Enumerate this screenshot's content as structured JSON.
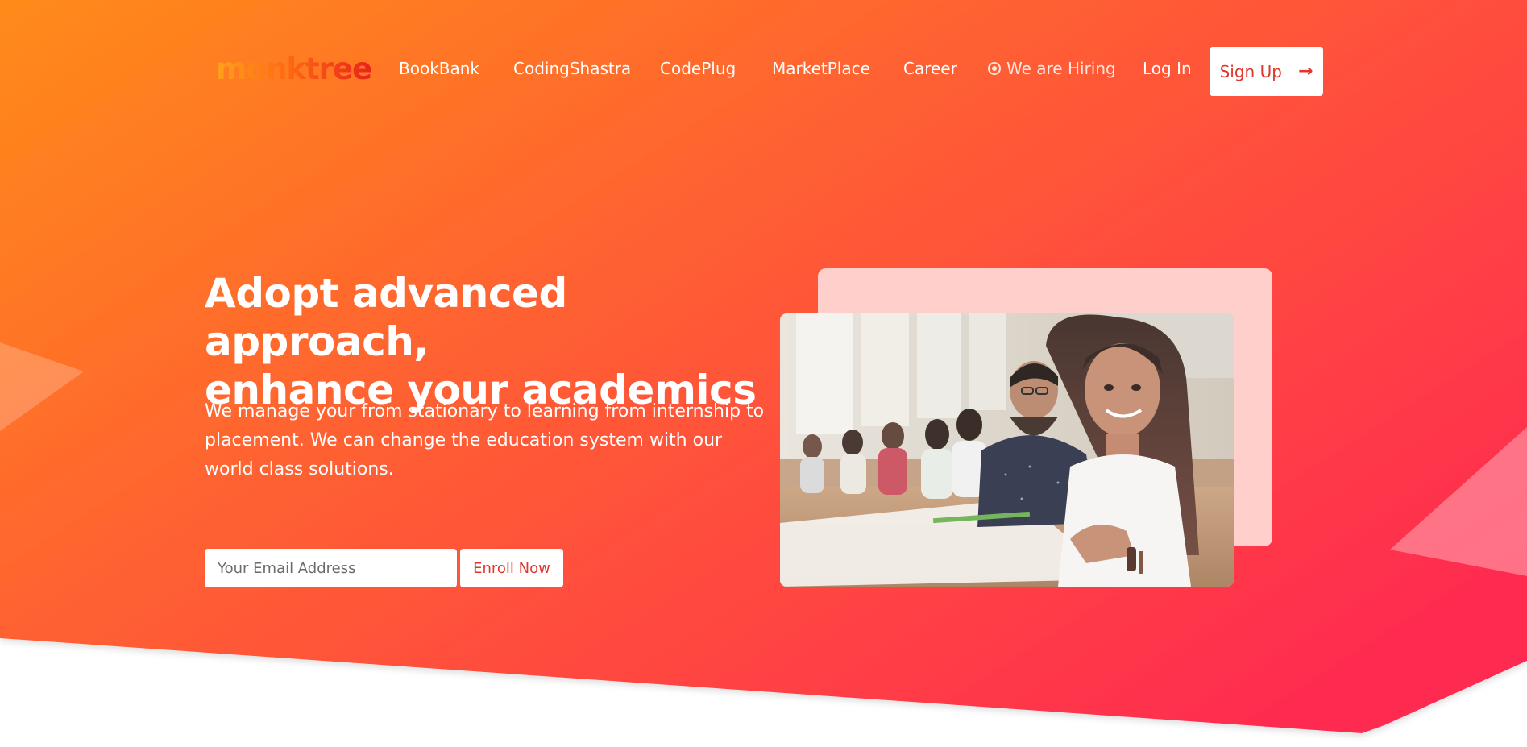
{
  "brand": {
    "logo_text": "monktree",
    "accent": "#e0362b",
    "gradient_start": "#ff8c1a",
    "gradient_end": "#ff2e4f"
  },
  "nav": {
    "items": [
      {
        "label": "BookBank"
      },
      {
        "label": "CodingShastra"
      },
      {
        "label": "CodePlug"
      },
      {
        "label": "MarketPlace"
      },
      {
        "label": "Career"
      }
    ],
    "hiring": {
      "label": "We are Hiring",
      "icon": "radio-dot-icon"
    },
    "login_label": "Log In",
    "signup_label": "Sign Up",
    "signup_icon": "arrow-right-icon"
  },
  "hero": {
    "headline_line1": "Adopt advanced approach,",
    "headline_line2": "enhance your academics",
    "description": "We manage your from stationary to learning from internship to placement. We can change the education system with our world class solutions.",
    "email_placeholder": "Your Email Address",
    "email_value": "",
    "enroll_label": "Enroll Now"
  }
}
